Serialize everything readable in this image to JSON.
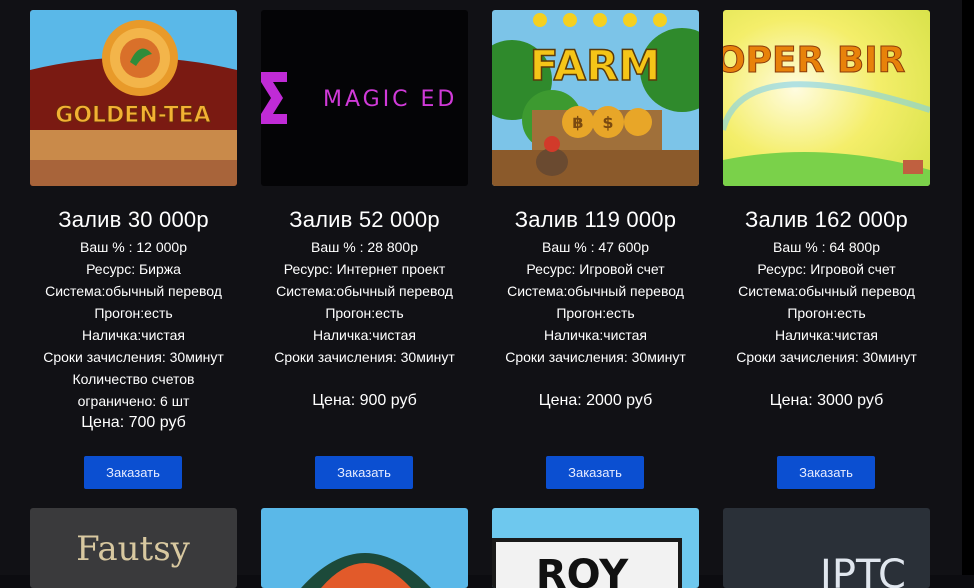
{
  "colors": {
    "button": "#0b4fd1",
    "background": "#111115",
    "text": "#ffffff"
  },
  "cards": [
    {
      "image_text": "GOLDEN-TEA",
      "title": "Залив 30 000р",
      "lines": [
        "Ваш % : 12 000р",
        "Ресурс: Биржа",
        "Система:обычный перевод",
        "Прогон:есть",
        "Наличка:чистая",
        "Сроки зачисления: 30минут",
        "Количество счетов",
        "ограничено: 6 шт"
      ],
      "price": "Цена: 700 руб",
      "button": "Заказать"
    },
    {
      "image_text": "MAGIC ED",
      "title": "Залив 52 000р",
      "lines": [
        "Ваш % : 28 800р",
        "Ресурс: Интернет проект",
        "Система:обычный перевод",
        "Прогон:есть",
        "Наличка:чистая",
        "Сроки зачисления: 30минут"
      ],
      "price": "Цена: 900 руб",
      "button": "Заказать"
    },
    {
      "image_text": "FARM",
      "title": "Залив 119 000р",
      "lines": [
        "Ваш % : 47 600р",
        "Ресурс: Игровой счет",
        "Система:обычный перевод",
        "Прогон:есть",
        "Наличка:чистая",
        "Сроки зачисления: 30минут"
      ],
      "price": "Цена: 2000 руб",
      "button": "Заказать"
    },
    {
      "image_text": "OPER BIR",
      "title": "Залив 162 000р",
      "lines": [
        "Ваш % : 64 800р",
        "Ресурс: Игровой счет",
        "Система:обычный перевод",
        "Прогон:есть",
        "Наличка:чистая",
        "Сроки зачисления: 30минут"
      ],
      "price": "Цена: 3000 руб",
      "button": "Заказать"
    }
  ],
  "row2": [
    {
      "image_text": "Fautsy"
    },
    {
      "image_text": ""
    },
    {
      "image_text": "ROY"
    },
    {
      "image_text": "IPTC"
    }
  ]
}
